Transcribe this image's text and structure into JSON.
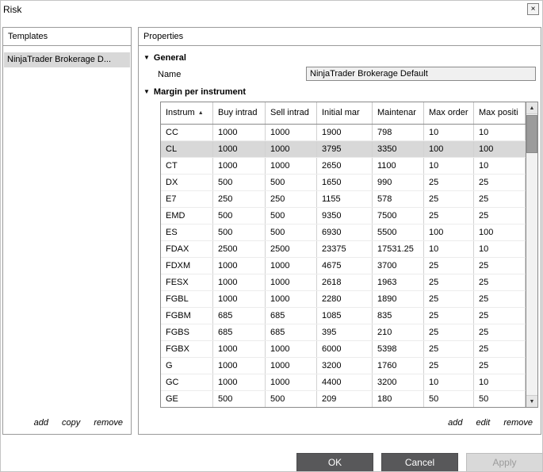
{
  "window": {
    "title": "Risk"
  },
  "icons": {
    "close": "×",
    "collapse": "▼",
    "sort_asc": "▲",
    "scroll_up": "▲",
    "scroll_down": "▼"
  },
  "templates_panel": {
    "header": "Templates",
    "selected_item": "NinjaTrader Brokerage D...",
    "actions": {
      "add": "add",
      "copy": "copy",
      "remove": "remove"
    }
  },
  "properties_panel": {
    "header": "Properties",
    "general": {
      "label": "General",
      "name_label": "Name",
      "name_value": "NinjaTrader Brokerage Default"
    },
    "margin": {
      "label": "Margin per instrument",
      "columns": [
        "Instrum",
        "Buy intrad",
        "Sell intrad",
        "Initial mar",
        "Maintenar",
        "Max order",
        "Max positi"
      ],
      "selected_row": 1,
      "rows": [
        [
          "CC",
          "1000",
          "1000",
          "1900",
          "798",
          "10",
          "10"
        ],
        [
          "CL",
          "1000",
          "1000",
          "3795",
          "3350",
          "100",
          "100"
        ],
        [
          "CT",
          "1000",
          "1000",
          "2650",
          "1100",
          "10",
          "10"
        ],
        [
          "DX",
          "500",
          "500",
          "1650",
          "990",
          "25",
          "25"
        ],
        [
          "E7",
          "250",
          "250",
          "1155",
          "578",
          "25",
          "25"
        ],
        [
          "EMD",
          "500",
          "500",
          "9350",
          "7500",
          "25",
          "25"
        ],
        [
          "ES",
          "500",
          "500",
          "6930",
          "5500",
          "100",
          "100"
        ],
        [
          "FDAX",
          "2500",
          "2500",
          "23375",
          "17531.25",
          "10",
          "10"
        ],
        [
          "FDXM",
          "1000",
          "1000",
          "4675",
          "3700",
          "25",
          "25"
        ],
        [
          "FESX",
          "1000",
          "1000",
          "2618",
          "1963",
          "25",
          "25"
        ],
        [
          "FGBL",
          "1000",
          "1000",
          "2280",
          "1890",
          "25",
          "25"
        ],
        [
          "FGBM",
          "685",
          "685",
          "1085",
          "835",
          "25",
          "25"
        ],
        [
          "FGBS",
          "685",
          "685",
          "395",
          "210",
          "25",
          "25"
        ],
        [
          "FGBX",
          "1000",
          "1000",
          "6000",
          "5398",
          "25",
          "25"
        ],
        [
          "G",
          "1000",
          "1000",
          "3200",
          "1760",
          "25",
          "25"
        ],
        [
          "GC",
          "1000",
          "1000",
          "4400",
          "3200",
          "10",
          "10"
        ],
        [
          "GE",
          "500",
          "500",
          "209",
          "180",
          "50",
          "50"
        ]
      ],
      "actions": {
        "add": "add",
        "edit": "edit",
        "remove": "remove"
      }
    }
  },
  "footer": {
    "ok": "OK",
    "cancel": "Cancel",
    "apply": "Apply"
  },
  "colors": {
    "button_dark": "#58585a",
    "selection": "#d8d8d8"
  }
}
